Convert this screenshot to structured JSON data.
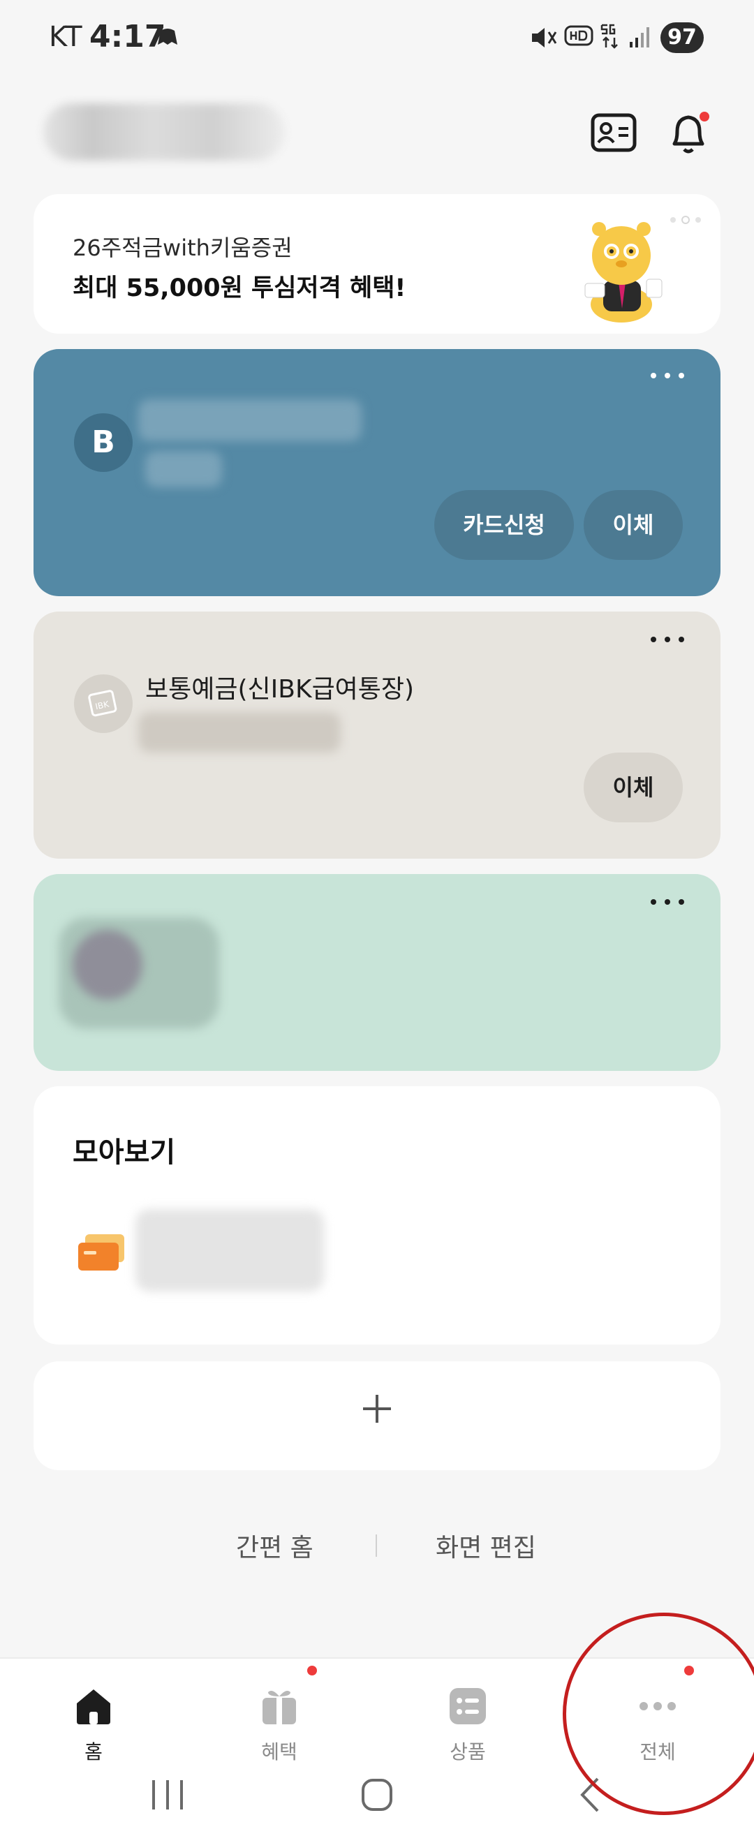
{
  "status_bar": {
    "carrier": "KT",
    "time": "4:17",
    "battery": "97"
  },
  "promo": {
    "line1": "26주적금with키움증권",
    "line2": "최대 55,000원 투심저격 혜택!"
  },
  "accounts": {
    "first": {
      "avatar_letter": "B",
      "buttons": {
        "card_apply": "카드신청",
        "transfer": "이체"
      }
    },
    "second": {
      "title": "보통예금(신IBK급여통장)",
      "buttons": {
        "transfer": "이체"
      }
    }
  },
  "moa": {
    "heading": "모아보기"
  },
  "footer_links": {
    "simple_home": "간편 홈",
    "edit_screen": "화면 편집"
  },
  "bottom_nav": [
    {
      "label": "홈",
      "icon": "home-icon",
      "active": true
    },
    {
      "label": "혜택",
      "icon": "gift-icon",
      "badge": true
    },
    {
      "label": "상품",
      "icon": "product-list-icon"
    },
    {
      "label": "전체",
      "icon": "more-dots-icon",
      "badge": true
    }
  ],
  "colors": {
    "background": "#f6f6f6",
    "account_blue": "#5489a5",
    "account_beige": "#e7e4de",
    "account_green": "#c8e4d8",
    "badge_red": "#ee3b3b",
    "highlight_circle": "#c41e1e"
  }
}
